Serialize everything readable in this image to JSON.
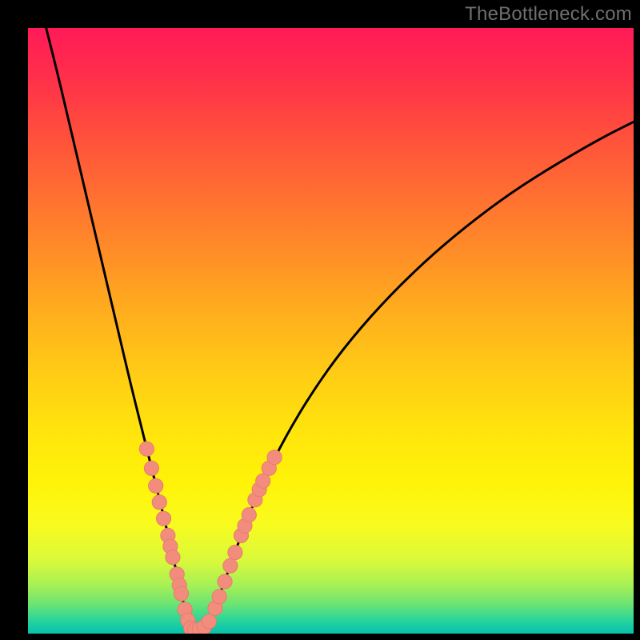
{
  "watermark": {
    "text": "TheBottleneck.com"
  },
  "colors": {
    "curve_stroke": "#000000",
    "marker_fill": "#f28d7d",
    "marker_stroke": "#e97b6e",
    "gradient_stops": [
      "#ff1a57",
      "#ff2f4b",
      "#ff4a3e",
      "#ff6a33",
      "#ff8a28",
      "#ffab1e",
      "#ffc916",
      "#ffe30d",
      "#fff308",
      "#f8fb1f",
      "#d9f93a",
      "#a6f055",
      "#6fe471",
      "#3dd98e",
      "#19cfa5",
      "#0cc0a8"
    ]
  },
  "chart_data": {
    "type": "line",
    "title": "",
    "xlabel": "",
    "ylabel": "",
    "xlim": [
      0,
      100
    ],
    "ylim": [
      0,
      100
    ],
    "grid": false,
    "legend": false,
    "curve": {
      "comment": "Approximate V-shaped bottleneck curve. x is horizontal position (0..100 left→right), y is vertical value (0 at bottom, 100 at top). Minimum (valley) sits near x≈27, y≈0.",
      "points": [
        {
          "x": 3.0,
          "y": 100.0
        },
        {
          "x": 5.0,
          "y": 92.0
        },
        {
          "x": 7.0,
          "y": 83.5
        },
        {
          "x": 9.0,
          "y": 75.0
        },
        {
          "x": 11.0,
          "y": 66.5
        },
        {
          "x": 13.0,
          "y": 58.0
        },
        {
          "x": 15.0,
          "y": 49.5
        },
        {
          "x": 17.0,
          "y": 41.0
        },
        {
          "x": 19.0,
          "y": 33.0
        },
        {
          "x": 21.0,
          "y": 25.0
        },
        {
          "x": 22.5,
          "y": 19.0
        },
        {
          "x": 24.0,
          "y": 12.5
        },
        {
          "x": 25.2,
          "y": 7.0
        },
        {
          "x": 26.2,
          "y": 3.0
        },
        {
          "x": 27.3,
          "y": 0.7
        },
        {
          "x": 28.7,
          "y": 0.7
        },
        {
          "x": 30.0,
          "y": 2.5
        },
        {
          "x": 31.5,
          "y": 6.0
        },
        {
          "x": 33.5,
          "y": 11.5
        },
        {
          "x": 36.0,
          "y": 18.5
        },
        {
          "x": 39.0,
          "y": 25.5
        },
        {
          "x": 42.5,
          "y": 32.5
        },
        {
          "x": 47.0,
          "y": 40.0
        },
        {
          "x": 52.0,
          "y": 47.0
        },
        {
          "x": 58.0,
          "y": 54.0
        },
        {
          "x": 65.0,
          "y": 61.0
        },
        {
          "x": 72.0,
          "y": 67.0
        },
        {
          "x": 80.0,
          "y": 73.0
        },
        {
          "x": 88.0,
          "y": 78.0
        },
        {
          "x": 95.0,
          "y": 82.0
        },
        {
          "x": 100.0,
          "y": 84.5
        }
      ]
    },
    "markers": {
      "radius": 1.2,
      "comment": "Pink/salmon circular markers clustered on both walls of the valley and along its floor (lower ~30% of the plot).",
      "points": [
        {
          "x": 19.6,
          "y": 30.5
        },
        {
          "x": 20.4,
          "y": 27.3
        },
        {
          "x": 21.1,
          "y": 24.4
        },
        {
          "x": 21.7,
          "y": 21.7
        },
        {
          "x": 22.4,
          "y": 19.0
        },
        {
          "x": 23.1,
          "y": 16.2
        },
        {
          "x": 23.5,
          "y": 14.4
        },
        {
          "x": 23.9,
          "y": 12.6
        },
        {
          "x": 24.6,
          "y": 9.8
        },
        {
          "x": 25.0,
          "y": 8.0
        },
        {
          "x": 25.3,
          "y": 6.6
        },
        {
          "x": 25.9,
          "y": 4.0
        },
        {
          "x": 26.4,
          "y": 2.2
        },
        {
          "x": 26.9,
          "y": 0.9
        },
        {
          "x": 27.5,
          "y": 0.6
        },
        {
          "x": 28.3,
          "y": 0.7
        },
        {
          "x": 29.1,
          "y": 1.1
        },
        {
          "x": 29.9,
          "y": 2.0
        },
        {
          "x": 30.9,
          "y": 4.2
        },
        {
          "x": 31.6,
          "y": 6.1
        },
        {
          "x": 32.5,
          "y": 8.6
        },
        {
          "x": 33.4,
          "y": 11.2
        },
        {
          "x": 34.2,
          "y": 13.4
        },
        {
          "x": 35.2,
          "y": 16.2
        },
        {
          "x": 35.8,
          "y": 17.8
        },
        {
          "x": 36.5,
          "y": 19.6
        },
        {
          "x": 37.5,
          "y": 22.1
        },
        {
          "x": 38.2,
          "y": 23.8
        },
        {
          "x": 38.8,
          "y": 25.2
        },
        {
          "x": 39.8,
          "y": 27.3
        },
        {
          "x": 40.7,
          "y": 29.1
        }
      ]
    }
  }
}
